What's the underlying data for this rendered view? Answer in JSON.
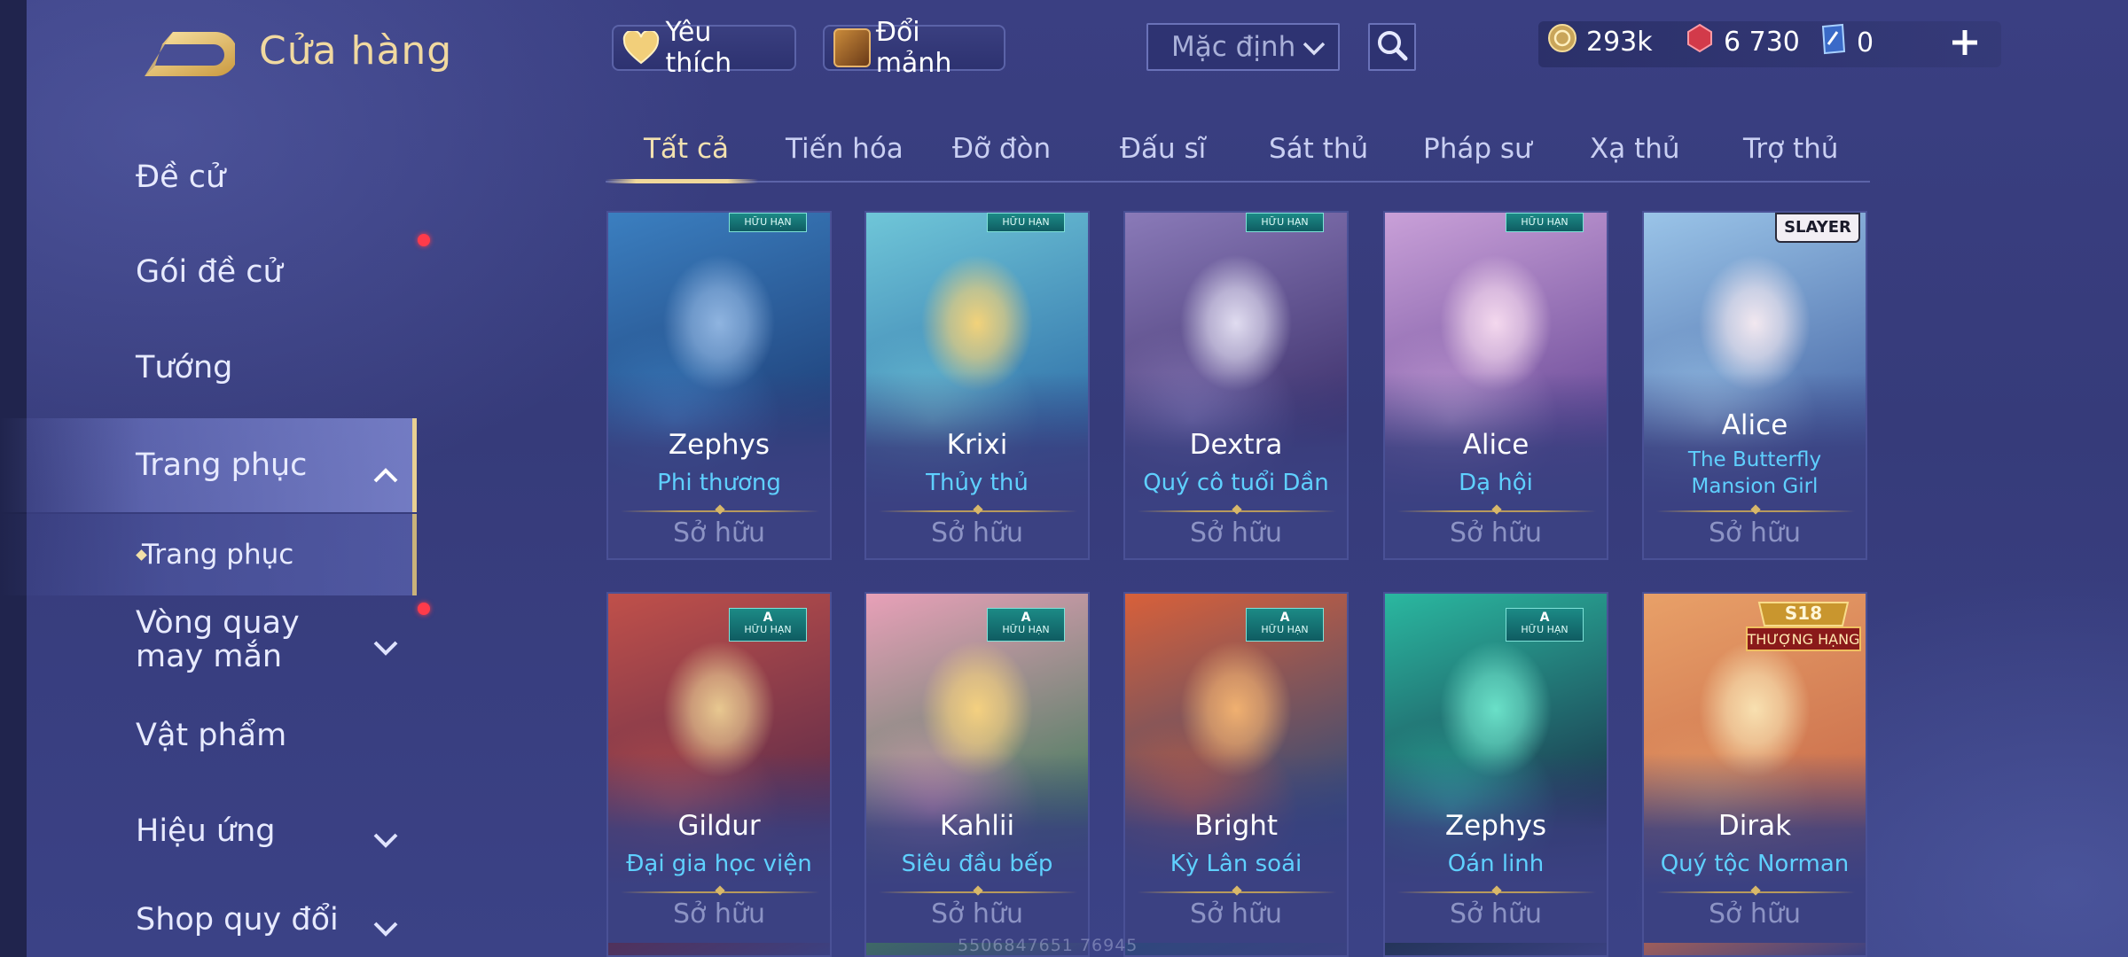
{
  "header": {
    "title": "Cửa hàng",
    "favorite_label": "Yêu thích",
    "exchange_label": "Đổi mảnh",
    "sort_value": "Mặc định"
  },
  "currency": {
    "gold": "293k",
    "ruby": "6 730",
    "voucher": "0"
  },
  "sidebar": {
    "items": [
      {
        "label": "Đề cử"
      },
      {
        "label": "Gói đề cử"
      },
      {
        "label": "Tướng"
      },
      {
        "label": "Trang phục"
      },
      {
        "label": "Trang phục"
      },
      {
        "label": "Vòng quay may mắn"
      },
      {
        "label": "Vật phẩm"
      },
      {
        "label": "Hiệu ứng"
      },
      {
        "label": "Shop quy đổi"
      }
    ]
  },
  "tabs": [
    "Tất cả",
    "Tiến hóa",
    "Đỡ đòn",
    "Đấu sĩ",
    "Sát thủ",
    "Pháp sư",
    "Xạ thủ",
    "Trợ thủ"
  ],
  "cards": [
    {
      "hero": "Zephys",
      "skin": "Phi thương",
      "status": "Sở hữu",
      "badge": "HỮU HẠN",
      "colors": [
        "#3b7fc0",
        "#1e3f78",
        "#8fb4e0"
      ]
    },
    {
      "hero": "Krixi",
      "skin": "Thủy thủ",
      "status": "Sở hữu",
      "badge": "HỮU HẠN",
      "colors": [
        "#6fc6d8",
        "#2f6fa8",
        "#f2d27a"
      ]
    },
    {
      "hero": "Dextra",
      "skin": "Quý cô tuổi Dần",
      "status": "Sở hữu",
      "badge": "HỮU HẠN",
      "colors": [
        "#8a7ab8",
        "#3b2f6a",
        "#e0dcf0"
      ]
    },
    {
      "hero": "Alice",
      "skin": "Dạ hội",
      "status": "Sở hữu",
      "badge": "HỮU HẠN",
      "colors": [
        "#c9a0d8",
        "#6a4a98",
        "#f4d8ee"
      ]
    },
    {
      "hero": "Alice",
      "skin": "The Butterfly Mansion Girl",
      "status": "Sở hữu",
      "badge": "SLAYER",
      "colors": [
        "#9ac4e8",
        "#4a6aa8",
        "#f2e8f0"
      ]
    },
    {
      "hero": "Gildur",
      "skin": "Đại gia học viện",
      "status": "Sở hữu",
      "badge": "HỮU HẠN",
      "badge_letter": "A",
      "colors": [
        "#c0504a",
        "#5a2a4a",
        "#e8c890"
      ]
    },
    {
      "hero": "Kahlii",
      "skin": "Siêu đầu bếp",
      "status": "Sở hữu",
      "badge": "HỮU HẠN",
      "badge_letter": "A",
      "colors": [
        "#e8a0b8",
        "#3f7a5a",
        "#f4d080"
      ]
    },
    {
      "hero": "Bright",
      "skin": "Kỳ Lân soái",
      "status": "Sở hữu",
      "badge": "HỮU HẠN",
      "badge_letter": "A",
      "colors": [
        "#d8603a",
        "#2a4a7a",
        "#f0b070"
      ]
    },
    {
      "hero": "Zephys",
      "skin": "Oán linh",
      "status": "Sở hữu",
      "badge": "HỮU HẠN",
      "badge_letter": "A",
      "colors": [
        "#2ab8a0",
        "#1a2f48",
        "#6ae0c8"
      ]
    },
    {
      "hero": "Dirak",
      "skin": "Quý tộc Norman",
      "status": "Sở hữu",
      "badge": "S18 THƯỢNG HẠNG",
      "colors": [
        "#e8a068",
        "#c86a4a",
        "#f8e0b0"
      ]
    }
  ],
  "watermark": "5506847651 76945",
  "colors": {
    "accent_gold": "#f1d9a0",
    "skin_name": "#5fd0ff",
    "red_notification": "#ff3b4a"
  }
}
